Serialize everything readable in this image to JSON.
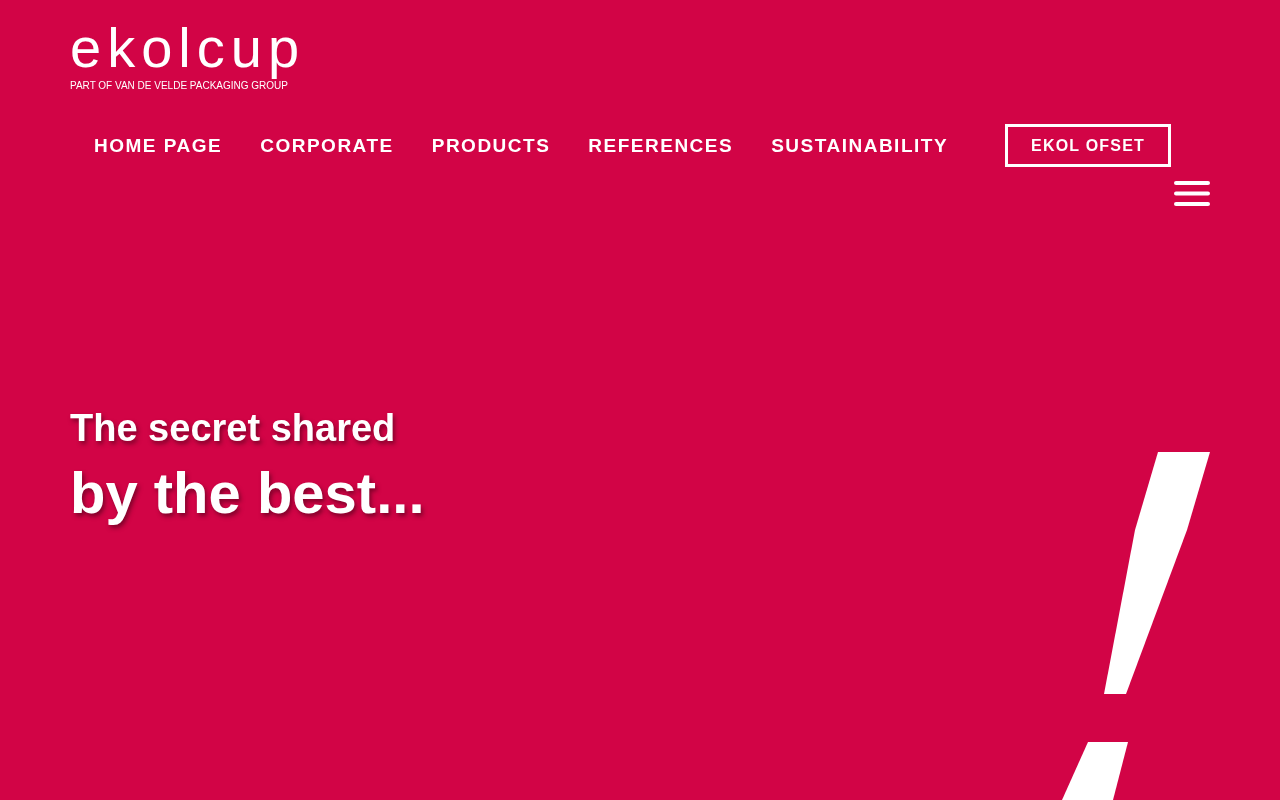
{
  "header": {
    "logo": {
      "wordmark": "ekolcup",
      "tagline": "PART OF VAN DE VELDE PACKAGING GROUP"
    }
  },
  "nav": {
    "items": [
      "HOME PAGE",
      "CORPORATE",
      "PRODUCTS",
      "REFERENCES",
      "SUSTAINABILITY"
    ],
    "button": "EKOL OFSET"
  },
  "hero": {
    "line_1": "The secret shared",
    "line_2": "by the best..."
  }
}
